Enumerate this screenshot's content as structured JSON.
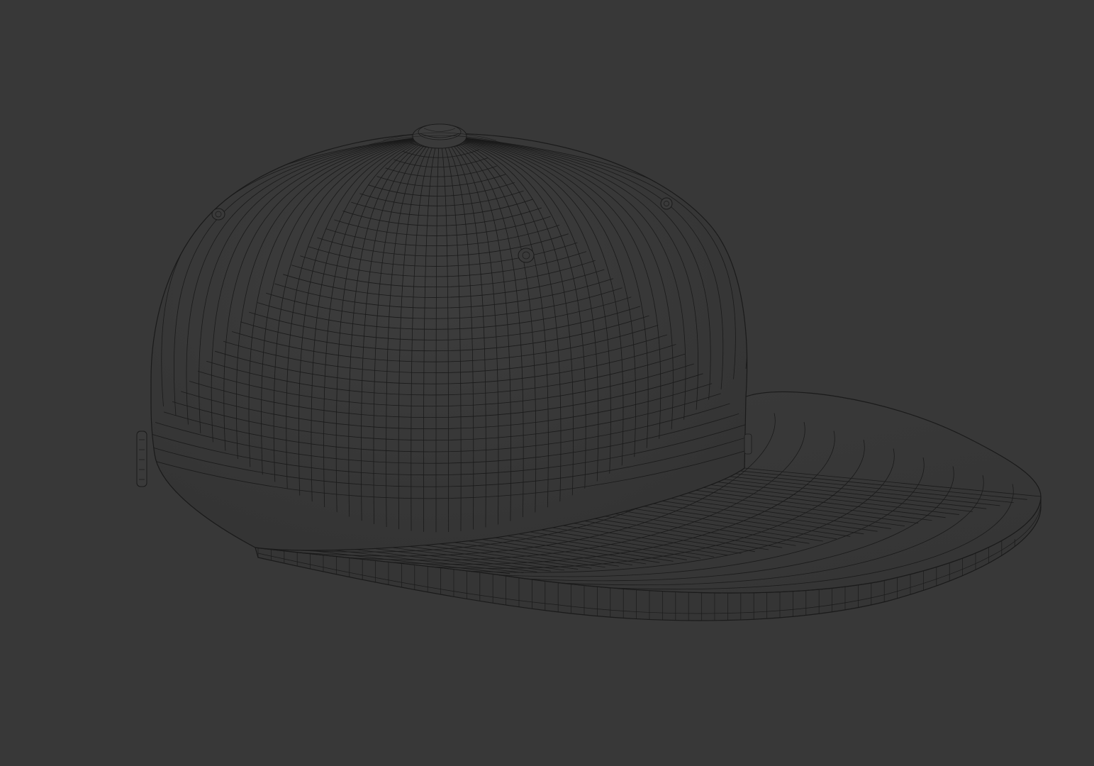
{
  "viewport": {
    "background_color": "#383838",
    "model_fill_color": "#373737",
    "wire_color": "#1a1a1a",
    "model": "baseball-cap",
    "shading": "wireframe"
  }
}
